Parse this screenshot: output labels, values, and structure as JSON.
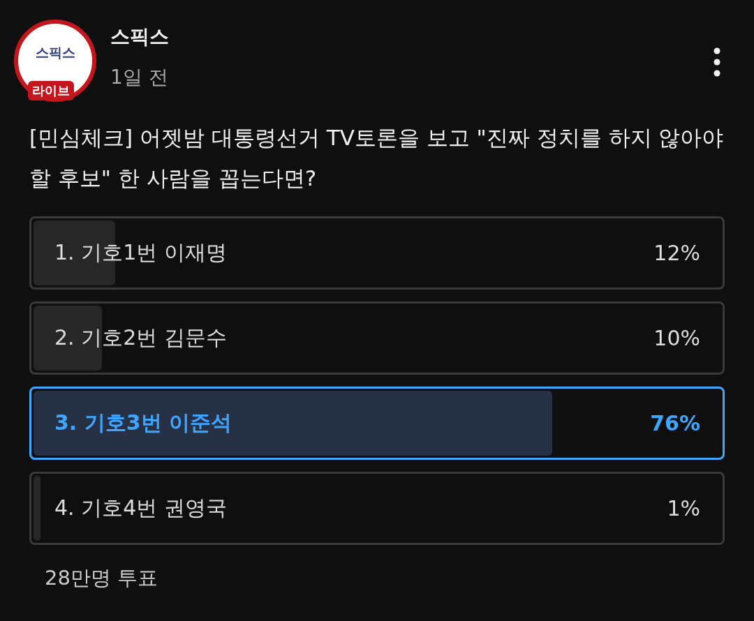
{
  "channel": {
    "avatar": {
      "logo_text": "스픽스",
      "badge_text": "라이브"
    },
    "name": "스픽스",
    "time": "1일 전"
  },
  "question": "[민심체크] 어젯밤 대통령선거 TV토론을 보고 \"진짜 정치를 하지 않아야 할 후보\" 한 사람을 꼽는다면?",
  "options": [
    {
      "label": "1. 기호1번 이재명",
      "percent": "12%",
      "level": 0.12,
      "selected": false
    },
    {
      "label": "2. 기호2번 김문수",
      "percent": "10%",
      "level": 0.1,
      "selected": false
    },
    {
      "label": "3. 기호3번 이준석",
      "percent": "76%",
      "level": 0.76,
      "selected": true
    },
    {
      "label": "4. 기호4번 권영국",
      "percent": "1%",
      "level": 0.01,
      "selected": false
    }
  ],
  "votes": "28만명 투표"
}
